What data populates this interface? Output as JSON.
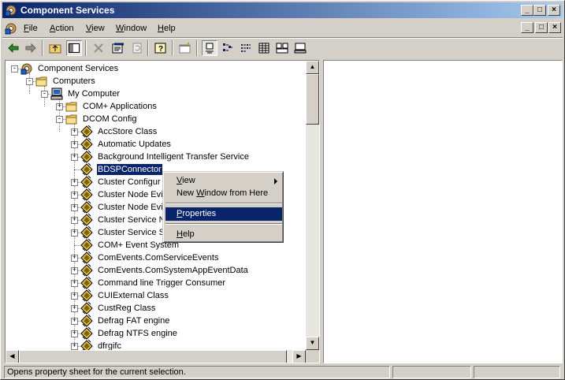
{
  "window": {
    "title": "Component Services",
    "buttons": {
      "minimize": "_",
      "maximize": "□",
      "close": "×"
    }
  },
  "menubar": {
    "items": [
      {
        "label": "File",
        "accel": "F",
        "rest": "ile"
      },
      {
        "label": "Action",
        "accel": "A",
        "rest": "ction"
      },
      {
        "label": "View",
        "accel": "V",
        "rest": "iew"
      },
      {
        "label": "Window",
        "accel": "W",
        "rest": "indow"
      },
      {
        "label": "Help",
        "accel": "H",
        "rest": "elp"
      }
    ]
  },
  "toolbar": {
    "icons": [
      "back-icon",
      "forward-icon",
      "up-folder-icon",
      "show-hide-tree-icon",
      "delete-icon",
      "properties-icon",
      "refresh-icon",
      "help-icon",
      "new-window-icon",
      "large-icons-icon",
      "small-icons-icon",
      "list-icon",
      "details-icon",
      "status-view-icon"
    ]
  },
  "tree": {
    "nodes": [
      {
        "label": "Component Services",
        "level": 0,
        "expander": "-",
        "icon": "component-services-icon"
      },
      {
        "label": "Computers",
        "level": 1,
        "expander": "-",
        "icon": "folder-icon"
      },
      {
        "label": "My Computer",
        "level": 2,
        "expander": "-",
        "icon": "computer-icon"
      },
      {
        "label": "COM+ Applications",
        "level": 3,
        "expander": "+",
        "icon": "folder-icon"
      },
      {
        "label": "DCOM Config",
        "level": 3,
        "expander": "-",
        "icon": "folder-icon"
      },
      {
        "label": "AccStore Class",
        "level": 4,
        "expander": "+",
        "icon": "com-component-icon"
      },
      {
        "label": "Automatic Updates",
        "level": 4,
        "expander": "+",
        "icon": "com-component-icon"
      },
      {
        "label": "Background Intelligent Transfer Service",
        "level": 4,
        "expander": "+",
        "icon": "com-component-icon"
      },
      {
        "label": "BDSPConnector",
        "level": 4,
        "expander": "",
        "icon": "com-component-icon",
        "selected": true
      },
      {
        "label": "Cluster Configur",
        "level": 4,
        "expander": "+",
        "icon": "com-component-icon"
      },
      {
        "label": "Cluster Node Evi",
        "level": 4,
        "expander": "+",
        "icon": "com-component-icon"
      },
      {
        "label": "Cluster Node Evi",
        "level": 4,
        "expander": "+",
        "icon": "com-component-icon"
      },
      {
        "label": "Cluster Service N",
        "level": 4,
        "expander": "+",
        "icon": "com-component-icon"
      },
      {
        "label": "Cluster Service S",
        "level": 4,
        "expander": "+",
        "icon": "com-component-icon"
      },
      {
        "label": "COM+ Event System",
        "level": 4,
        "expander": "",
        "icon": "com-component-icon"
      },
      {
        "label": "ComEvents.ComServiceEvents",
        "level": 4,
        "expander": "+",
        "icon": "com-component-icon"
      },
      {
        "label": "ComEvents.ComSystemAppEventData",
        "level": 4,
        "expander": "+",
        "icon": "com-component-icon"
      },
      {
        "label": "Command line Trigger Consumer",
        "level": 4,
        "expander": "+",
        "icon": "com-component-icon"
      },
      {
        "label": "CUIExternal Class",
        "level": 4,
        "expander": "+",
        "icon": "com-component-icon"
      },
      {
        "label": "CustReg Class",
        "level": 4,
        "expander": "+",
        "icon": "com-component-icon"
      },
      {
        "label": "Defrag FAT engine",
        "level": 4,
        "expander": "+",
        "icon": "com-component-icon"
      },
      {
        "label": "Defrag NTFS engine",
        "level": 4,
        "expander": "+",
        "icon": "com-component-icon"
      },
      {
        "label": "dfrgifc",
        "level": 4,
        "expander": "+",
        "icon": "com-component-icon"
      }
    ]
  },
  "context_menu": {
    "items": [
      {
        "label": "View",
        "accel": "V",
        "rest": "iew",
        "submenu": true
      },
      {
        "label": "New Window from Here",
        "pre": "New ",
        "accel": "W",
        "rest": "indow from Here"
      },
      {
        "label": "Properties",
        "accel": "P",
        "rest": "roperties",
        "highlighted": true
      },
      {
        "label": "Help",
        "accel": "H",
        "rest": "elp"
      }
    ]
  },
  "statusbar": {
    "message": "Opens property sheet for the current selection."
  },
  "colors": {
    "title_active": "#0a246a",
    "face": "#d4d0c8",
    "selection": "#0a246a"
  }
}
